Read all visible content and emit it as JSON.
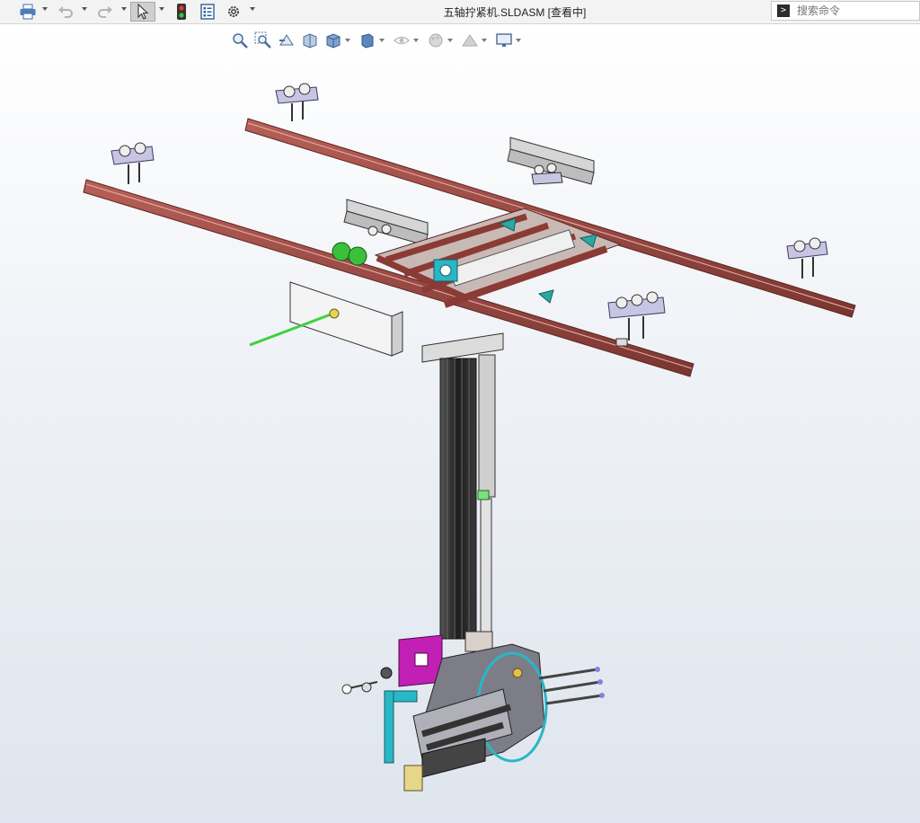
{
  "window": {
    "title": "五轴拧紧机.SLDASM [查看中]"
  },
  "toolbar": {
    "items": [
      {
        "name": "print-icon",
        "has_caret": true
      },
      {
        "name": "undo-icon",
        "has_caret": true
      },
      {
        "name": "redo-icon",
        "has_caret": true
      },
      {
        "name": "select-pointer-icon",
        "has_caret": true
      },
      {
        "name": "traffic-light-icon",
        "has_caret": false
      },
      {
        "name": "file-properties-icon",
        "has_caret": false
      },
      {
        "name": "options-gear-icon",
        "has_caret": true
      }
    ]
  },
  "search": {
    "placeholder": "搜索命令"
  },
  "view_toolbar": {
    "items": [
      "zoom-to-fit-icon",
      "zoom-to-area-icon",
      "previous-view-icon",
      "section-view-icon",
      "view-orientation-icon",
      "display-style-icon",
      "hide-show-items-icon",
      "edit-appearance-icon",
      "apply-scene-icon",
      "view-settings-icon"
    ]
  },
  "colors": {
    "rail": "#9c4a44",
    "rail_dark": "#6e2f2b",
    "frame_gray": "#c9c9c9",
    "column": "#2a2a2a",
    "accent_cyan": "#29b7c6",
    "accent_magenta": "#c21fb5",
    "accent_green": "#3cd23c",
    "trolley": "#b9b4d8"
  }
}
